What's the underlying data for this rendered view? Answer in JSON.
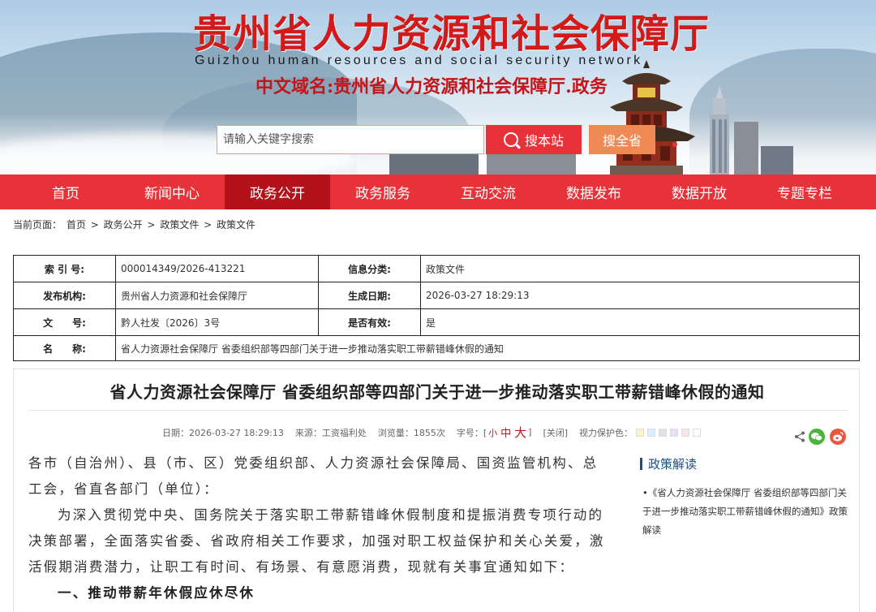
{
  "header": {
    "title": "贵州省人力资源和社会保障厅",
    "subtitle": "Guizhou human resources and social security network",
    "domain": "中文域名:贵州省人力资源和社会保障厅.政务"
  },
  "search": {
    "placeholder": "请输入关键字搜索",
    "site_button": "搜本站",
    "province_button": "搜全省"
  },
  "nav": {
    "items": [
      {
        "label": "首页"
      },
      {
        "label": "新闻中心"
      },
      {
        "label": "政务公开",
        "active": true
      },
      {
        "label": "政务服务"
      },
      {
        "label": "互动交流"
      },
      {
        "label": "数据发布"
      },
      {
        "label": "数据开放"
      },
      {
        "label": "专题专栏"
      }
    ]
  },
  "breadcrumb": {
    "prefix": "当前页面：",
    "items": [
      "首页",
      "政务公开",
      "政策文件",
      "政策文件"
    ],
    "separator": ">"
  },
  "info": {
    "index_label": "索 引 号:",
    "index_value": "000014349/2026-413221",
    "category_label": "信息分类:",
    "category_value": "政策文件",
    "issuer_label": "发布机构:",
    "issuer_value": "贵州省人力资源和社会保障厅",
    "date_label": "生成日期:",
    "date_value": "2026-03-27 18:29:13",
    "docno_label": "文　　号:",
    "docno_value": "黔人社发〔2026〕3号",
    "valid_label": "是否有效:",
    "valid_value": "是",
    "name_label": "名　　称:",
    "name_value": "省人力资源社会保障厅 省委组织部等四部门关于进一步推动落实职工带薪错峰休假的通知"
  },
  "article": {
    "title": "省人力资源社会保障厅 省委组织部等四部门关于进一步推动落实职工带薪错峰休假的通知",
    "meta": {
      "date": "日期：2026-03-27 18:29:13",
      "source": "来源：工资福利处",
      "views": "浏览量：1855次",
      "fontsize_label": "字号：[",
      "font_small": "小",
      "font_mid": "中",
      "font_big": "大",
      "fontsize_end": "]",
      "close": "[关闭]",
      "eye_label": "视力保护色：",
      "eye_colors": [
        "#fbf6c8",
        "#d8eefb",
        "#dfe3e8",
        "#e9dff2",
        "#fbe4ee",
        "#ffffff"
      ]
    },
    "paragraphs": [
      "各市（自治州）、县（市、区）党委组织部、人力资源社会保障局、国资监管机构、总工会，省直各部门（单位）：",
      "为深入贯彻党中央、国务院关于落实职工带薪错峰休假制度和提振消费专项行动的决策部署，全面落实省委、省政府相关工作要求，加强对职工权益保护和关心关爱，激活假期消费潜力，让职工有时间、有场景、有意愿消费，现就有关事宜通知如下："
    ],
    "heading1": "一、推动带薪年休假应休尽休"
  },
  "sidebar": {
    "title": "政策解读",
    "item": "•《省人力资源社会保障厅 省委组织部等四部门关于进一步推动落实职工带薪错峰休假的通知》政策解读"
  },
  "colors": {
    "brand_red": "#e8323a",
    "nav_active": "#b3121a",
    "title_red": "#d11a1a",
    "side_blue": "#1a4f8a",
    "search_province": "#f08a54"
  }
}
